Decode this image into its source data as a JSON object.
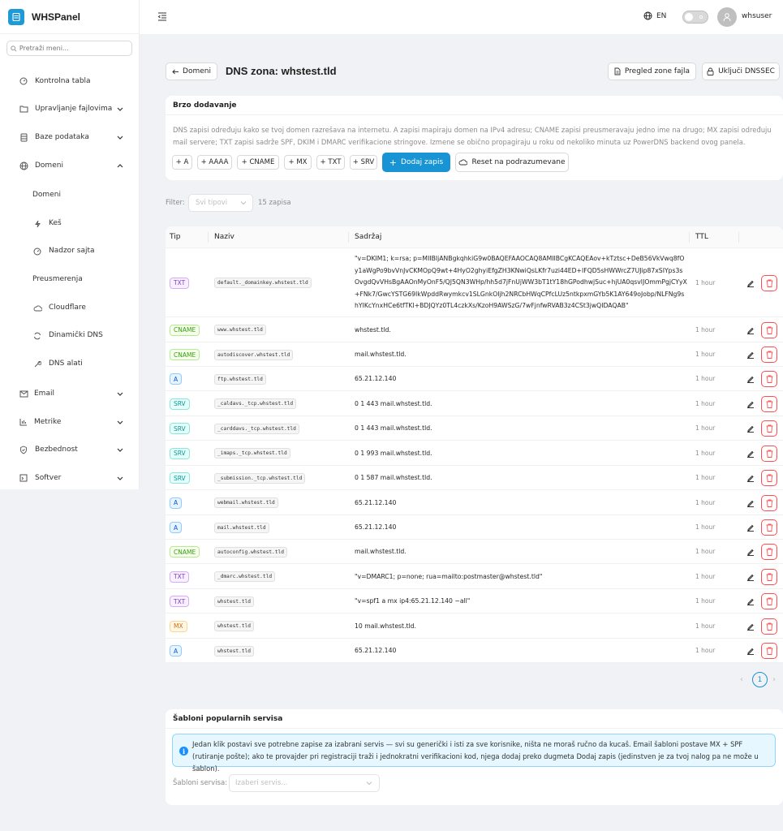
{
  "app": {
    "name": "WHSPanel"
  },
  "sidebar": {
    "search_placeholder": "Pretraži meni...",
    "items": [
      {
        "label": "Kontrolna tabla"
      },
      {
        "label": "Upravljanje fajlovima"
      },
      {
        "label": "Baze podataka"
      },
      {
        "label": "Domeni"
      },
      {
        "label": "Email"
      },
      {
        "label": "Metrike"
      },
      {
        "label": "Bezbednost"
      },
      {
        "label": "Softver"
      }
    ],
    "domeni_sub": [
      {
        "label": "Domeni"
      },
      {
        "label": "Keš"
      },
      {
        "label": "Nadzor sajta"
      },
      {
        "label": "Preusmerenja"
      },
      {
        "label": "Cloudflare"
      },
      {
        "label": "Dinamički DNS"
      },
      {
        "label": "DNS alati"
      }
    ]
  },
  "header": {
    "language": "EN",
    "username": "whsuser"
  },
  "page": {
    "back_label": "Domeni",
    "title": "DNS zona: whstest.tld",
    "zone_file_btn": "Pregled zone fajla",
    "dnssec_btn": "Uključi DNSSEC"
  },
  "quick_add": {
    "title": "Brzo dodavanje",
    "description": "DNS zapisi određuju kako se tvoj domen razrešava na internetu. A zapisi mapiraju domen na IPv4 adresu; CNAME zapisi preusmeravaju jedno ime na drugo; MX zapisi određuju mail servere; TXT zapisi sadrže SPF, DKIM i DMARC verifikacione stringove. Izmene se obično propagiraju u roku od nekoliko minuta uz PowerDNS backend ovog panela.",
    "chips": [
      "+ A",
      "+ AAAA",
      "+ CNAME",
      "+ MX",
      "+ TXT",
      "+ SRV"
    ],
    "add_btn": "Dodaj zapis",
    "reset_btn": "Reset na podrazumevane"
  },
  "filter": {
    "label": "Filter:",
    "placeholder": "Svi tipovi",
    "count": "15 zapisa"
  },
  "table": {
    "headers": {
      "type": "Tip",
      "name": "Naziv",
      "content": "Sadržaj",
      "ttl": "TTL"
    },
    "rows": [
      {
        "type": "TXT",
        "name": "default._domainkey.whstest.tld",
        "content": "\"v=DKIM1; k=rsa; p=MIIBIjANBgkqhkiG9w0BAQEFAAOCAQ8AMIIBCgKCAQEAov+kTztsc+DeB56VkVwq8fOy1aWgPo9bvVnJvCKMOpQ9wt+4HyO2ghyiEfgZH3KNwiQsLKfr7uzi44ED+IFQD5sHWWrcZ7UJip87xSIYps3sOvgdQvVHsBgAAOnMyOnF5/QJ5QN3WHp/hh5d7jFnUjWW3bT1tY18hGPodhwjSuc+hjUA0qsvIJOmmPgjCYyX+FNk7/GwcYSTG69IkWpddRwymkcv1SLGnkOIjh2NRCbHWqCPfcLUz5ntkpxmGYb5K1AY649oJobp/NLFNg9shYIKcYnxHCe6tfTKI+BDJQYz0TL4czkXs/KzoH9AWSzG/7wFjnfwRVAB3z4CSt3jwQIDAQAB\"",
        "ttl": "1 hour"
      },
      {
        "type": "CNAME",
        "name": "www.whstest.tld",
        "content": "whstest.tld.",
        "ttl": "1 hour"
      },
      {
        "type": "CNAME",
        "name": "autodiscover.whstest.tld",
        "content": "mail.whstest.tld.",
        "ttl": "1 hour"
      },
      {
        "type": "A",
        "name": "ftp.whstest.tld",
        "content": "65.21.12.140",
        "ttl": "1 hour"
      },
      {
        "type": "SRV",
        "name": "_caldavs._tcp.whstest.tld",
        "content": "0 1 443 mail.whstest.tld.",
        "ttl": "1 hour"
      },
      {
        "type": "SRV",
        "name": "_carddavs._tcp.whstest.tld",
        "content": "0 1 443 mail.whstest.tld.",
        "ttl": "1 hour"
      },
      {
        "type": "SRV",
        "name": "_imaps._tcp.whstest.tld",
        "content": "0 1 993 mail.whstest.tld.",
        "ttl": "1 hour"
      },
      {
        "type": "SRV",
        "name": "_submission._tcp.whstest.tld",
        "content": "0 1 587 mail.whstest.tld.",
        "ttl": "1 hour"
      },
      {
        "type": "A",
        "name": "webmail.whstest.tld",
        "content": "65.21.12.140",
        "ttl": "1 hour"
      },
      {
        "type": "A",
        "name": "mail.whstest.tld",
        "content": "65.21.12.140",
        "ttl": "1 hour"
      },
      {
        "type": "CNAME",
        "name": "autoconfig.whstest.tld",
        "content": "mail.whstest.tld.",
        "ttl": "1 hour"
      },
      {
        "type": "TXT",
        "name": "_dmarc.whstest.tld",
        "content": "\"v=DMARC1; p=none; rua=mailto:postmaster@whstest.tld\"",
        "ttl": "1 hour"
      },
      {
        "type": "TXT",
        "name": "whstest.tld",
        "content": "\"v=spf1 a mx ip4:65.21.12.140 ~all\"",
        "ttl": "1 hour"
      },
      {
        "type": "MX",
        "name": "whstest.tld",
        "content": "10 mail.whstest.tld.",
        "ttl": "1 hour"
      },
      {
        "type": "A",
        "name": "whstest.tld",
        "content": "65.21.12.140",
        "ttl": "1 hour"
      }
    ]
  },
  "pagination": {
    "current": "1"
  },
  "templates": {
    "title": "Šabloni popularnih servisa",
    "info": "Jedan klik postavi sve potrebne zapise za izabrani servis — svi su generički i isti za sve korisnike, ništa ne moraš ručno da kucaš. Email šabloni postave MX + SPF (rutiranje pošte); ako te provajder pri registraciji traži i jednokratni verifikacioni kod, njega dodaj preko dugmeta Dodaj zapis (jedinstven je za tvoj nalog pa ne može u šablon).",
    "select_label": "Šabloni servisa:",
    "select_placeholder": "Izaberi servis..."
  }
}
